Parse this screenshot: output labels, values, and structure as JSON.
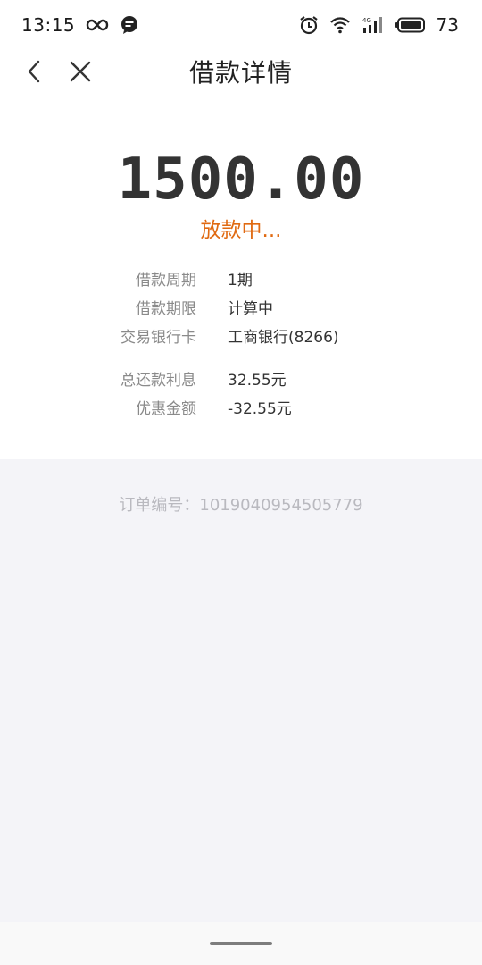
{
  "status_bar": {
    "time": "13:15",
    "battery": "73"
  },
  "header": {
    "title": "借款详情"
  },
  "loan": {
    "amount": "1500.00",
    "status": "放款中...",
    "status_color": "#e06a12",
    "details": [
      {
        "label": "借款周期",
        "value": "1期"
      },
      {
        "label": "借款期限",
        "value": "计算中"
      },
      {
        "label": "交易银行卡",
        "value": "工商银行(8266)"
      },
      {
        "label": "总还款利息",
        "value": "32.55元"
      },
      {
        "label": "优惠金额",
        "value": "-32.55元"
      }
    ]
  },
  "order": {
    "text": "订单编号：1019040954505779"
  }
}
